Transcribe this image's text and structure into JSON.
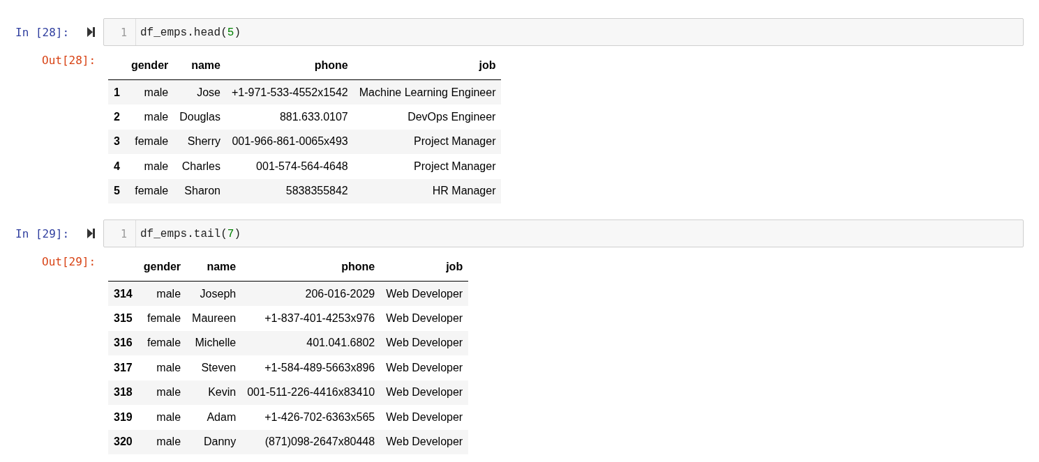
{
  "cells": [
    {
      "in_prompt": "In [28]:",
      "line_number": "1",
      "code": [
        {
          "kind": "plain",
          "text": "df_emps.head("
        },
        {
          "kind": "number",
          "text": "5"
        },
        {
          "kind": "plain",
          "text": ")"
        }
      ],
      "out_prompt": "Out[28]:",
      "table": {
        "columns": [
          "gender",
          "name",
          "phone",
          "job"
        ],
        "rows": [
          {
            "index": "1",
            "cells": [
              "male",
              "Jose",
              "+1-971-533-4552x1542",
              "Machine Learning Engineer"
            ]
          },
          {
            "index": "2",
            "cells": [
              "male",
              "Douglas",
              "881.633.0107",
              "DevOps Engineer"
            ]
          },
          {
            "index": "3",
            "cells": [
              "female",
              "Sherry",
              "001-966-861-0065x493",
              "Project Manager"
            ]
          },
          {
            "index": "4",
            "cells": [
              "male",
              "Charles",
              "001-574-564-4648",
              "Project Manager"
            ]
          },
          {
            "index": "5",
            "cells": [
              "female",
              "Sharon",
              "5838355842",
              "HR Manager"
            ]
          }
        ]
      }
    },
    {
      "in_prompt": "In [29]:",
      "line_number": "1",
      "code": [
        {
          "kind": "plain",
          "text": "df_emps.tail("
        },
        {
          "kind": "number",
          "text": "7"
        },
        {
          "kind": "plain",
          "text": ")"
        }
      ],
      "out_prompt": "Out[29]:",
      "table": {
        "columns": [
          "gender",
          "name",
          "phone",
          "job"
        ],
        "rows": [
          {
            "index": "314",
            "cells": [
              "male",
              "Joseph",
              "206-016-2029",
              "Web Developer"
            ]
          },
          {
            "index": "315",
            "cells": [
              "female",
              "Maureen",
              "+1-837-401-4253x976",
              "Web Developer"
            ]
          },
          {
            "index": "316",
            "cells": [
              "female",
              "Michelle",
              "401.041.6802",
              "Web Developer"
            ]
          },
          {
            "index": "317",
            "cells": [
              "male",
              "Steven",
              "+1-584-489-5663x896",
              "Web Developer"
            ]
          },
          {
            "index": "318",
            "cells": [
              "male",
              "Kevin",
              "001-511-226-4416x83410",
              "Web Developer"
            ]
          },
          {
            "index": "319",
            "cells": [
              "male",
              "Adam",
              "+1-426-702-6363x565",
              "Web Developer"
            ]
          },
          {
            "index": "320",
            "cells": [
              "male",
              "Danny",
              "(871)098-2647x80448",
              "Web Developer"
            ]
          }
        ]
      }
    }
  ]
}
